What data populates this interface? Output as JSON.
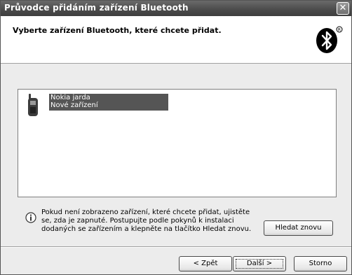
{
  "window": {
    "title": "Průvodce přidáním zařízení Bluetooth",
    "close_glyph": "✕"
  },
  "header": {
    "title": "Vyberte zařízení Bluetooth, které chcete přidat.",
    "logo_icon": "bluetooth-icon"
  },
  "device_list": {
    "items": [
      {
        "name": "Nokia jarda",
        "status": "Nové zařízení",
        "icon": "mobile-phone-icon",
        "selected": true
      }
    ]
  },
  "info": {
    "icon": "info-icon",
    "text": "Pokud není zobrazeno zařízení, které chcete přidat, ujistěte se, zda je zapnuté. Postupujte podle pokynů k instalaci dodaných se zařízením a klepněte na tlačítko Hledat znovu."
  },
  "buttons": {
    "search_again": "Hledat znovu",
    "back": "< Zpět",
    "next": "Další >",
    "cancel": "Storno"
  },
  "colors": {
    "titlebar": "#4a4a4a",
    "selection": "#555555",
    "dialog_bg": "#ececec"
  }
}
